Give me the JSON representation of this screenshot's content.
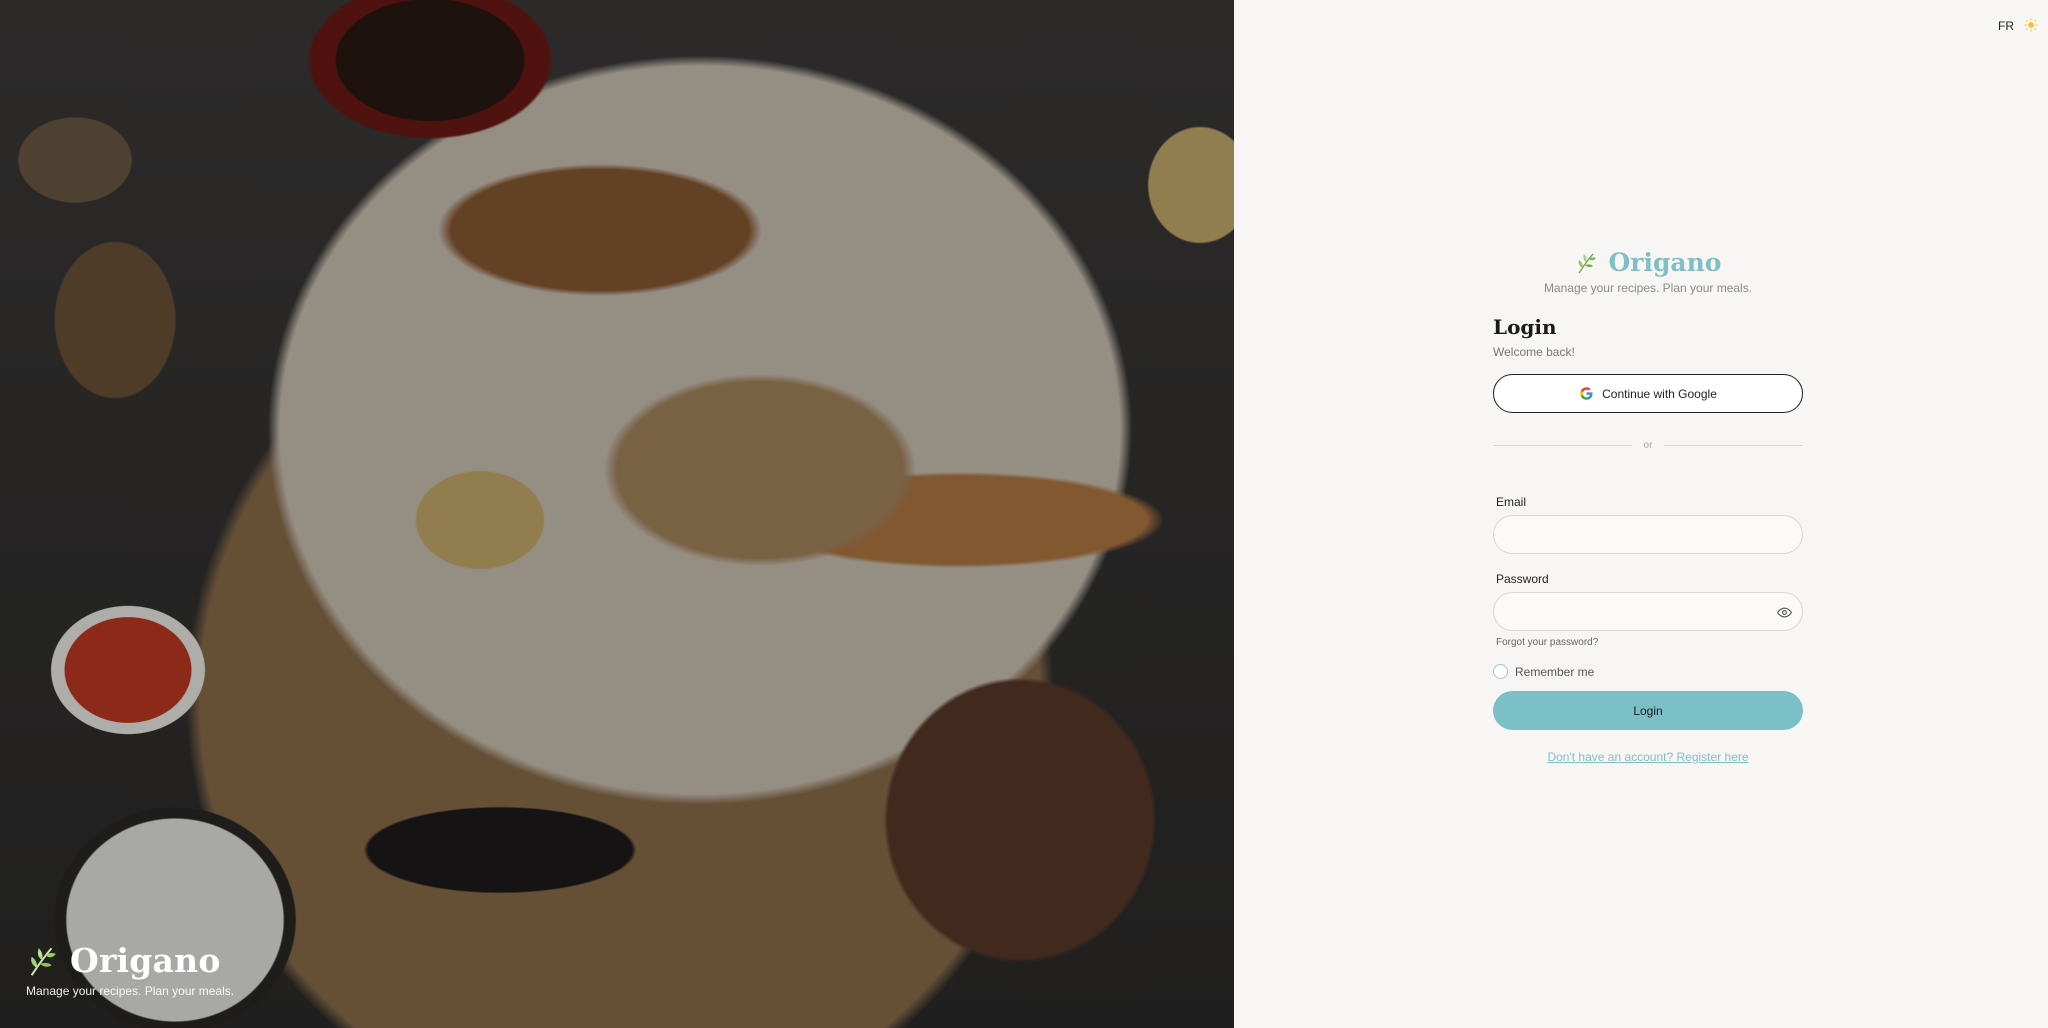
{
  "hero": {
    "brand_title": "Origano",
    "tagline": "Manage your recipes. Plan your meals."
  },
  "header": {
    "language": "FR",
    "theme_icon": "sun-icon"
  },
  "brand": {
    "title": "Origano",
    "tagline": "Manage your recipes. Plan your meals.",
    "logo_icon": "herb-leaf-icon"
  },
  "login": {
    "title": "Login",
    "subtitle": "Welcome back!",
    "google_label": "Continue with Google",
    "divider": "or",
    "email_label": "Email",
    "email_value": "",
    "password_label": "Password",
    "password_value": "",
    "forgot": "Forgot your password?",
    "remember": "Remember me",
    "submit": "Login",
    "register": "Don't have an account? Register here"
  },
  "colors": {
    "accent": "#7bbfc7",
    "background": "#f8f6f4",
    "text": "#1a1a1a"
  }
}
